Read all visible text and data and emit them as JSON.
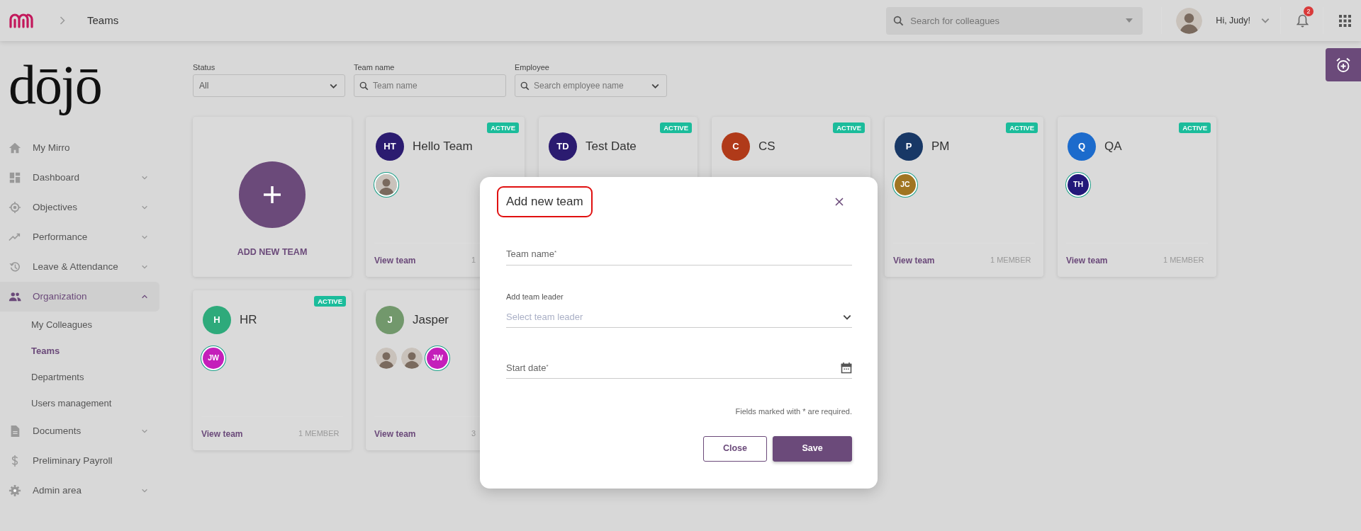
{
  "topbar": {
    "breadcrumb": "Teams",
    "search": {
      "placeholder": "Search for colleagues"
    },
    "greeting": "Hi, Judy!",
    "notifications": "2"
  },
  "sidebar": {
    "logo": "dōjō",
    "items": [
      {
        "kind": "home",
        "label": "My Mirro",
        "selected": false
      },
      {
        "kind": "dashboard",
        "label": "Dashboard",
        "expanded": false,
        "selected": false
      },
      {
        "kind": "objectives",
        "label": "Objectives",
        "expanded": false,
        "selected": false
      },
      {
        "kind": "performance",
        "label": "Performance",
        "expanded": false,
        "selected": false
      },
      {
        "kind": "leave",
        "label": "Leave & Attendance",
        "expanded": false,
        "selected": false
      },
      {
        "kind": "organization",
        "label": "Organization",
        "expanded": true,
        "selected": true,
        "children": [
          {
            "label": "My Colleagues",
            "selected": false
          },
          {
            "label": "Teams",
            "selected": true
          },
          {
            "label": "Departments",
            "selected": false
          },
          {
            "label": "Users management",
            "selected": false
          }
        ]
      },
      {
        "kind": "documents",
        "label": "Documents",
        "expanded": false,
        "selected": false
      },
      {
        "kind": "payroll",
        "label": "Preliminary Payroll",
        "selected": false
      },
      {
        "kind": "admin",
        "label": "Admin area",
        "expanded": false,
        "selected": false
      }
    ]
  },
  "filters": [
    {
      "kind": "select",
      "label": "Status",
      "value": "All"
    },
    {
      "kind": "search",
      "label": "Team name",
      "placeholder": "Team name"
    },
    {
      "kind": "search-select",
      "label": "Employee",
      "placeholder": "Search employee name"
    }
  ],
  "add_team_card": {
    "label": "ADD NEW TEAM"
  },
  "teams": [
    {
      "initials": "HT",
      "name": "Hello Team",
      "color": "#2b1b70",
      "status": "ACTIVE",
      "members": [
        {
          "kind": "photo",
          "outlined": true
        }
      ],
      "link": "View team",
      "member_count": "1"
    },
    {
      "initials": "TD",
      "name": "Test Date",
      "color": "#2b1b70",
      "status": "ACTIVE"
    },
    {
      "initials": "C",
      "name": "CS",
      "color": "#b03a19",
      "status": "ACTIVE"
    },
    {
      "initials": "P",
      "name": "PM",
      "color": "#183866",
      "status": "ACTIVE",
      "members": [
        {
          "kind": "initials",
          "initials": "JC",
          "color": "#a07522",
          "outlined": true
        }
      ],
      "link": "View team",
      "member_count": "1 MEMBER"
    },
    {
      "initials": "Q",
      "name": "QA",
      "color": "#1c6bcc",
      "status": "ACTIVE",
      "members": [
        {
          "kind": "initials",
          "initials": "TH",
          "color": "#23187a",
          "outlined": true
        }
      ],
      "link": "View team",
      "member_count": "1 MEMBER"
    },
    {
      "initials": "H",
      "name": "HR",
      "color": "#2eaa7b",
      "status": "ACTIVE",
      "members": [
        {
          "kind": "initials",
          "initials": "JW",
          "color": "#c41fba",
          "outlined": true
        }
      ],
      "link": "View team",
      "member_count": "1 MEMBER"
    },
    {
      "initials": "J",
      "name": "Jasper",
      "color": "#72986c",
      "members": [
        {
          "kind": "photo",
          "outlined": false
        },
        {
          "kind": "photo",
          "outlined": false
        },
        {
          "kind": "initials",
          "initials": "JW",
          "color": "#c41fba",
          "outlined": true
        }
      ],
      "link": "View team",
      "member_count": "3"
    }
  ],
  "modal": {
    "title": "Add new team",
    "fields": [
      {
        "kind": "text",
        "label": "Team name$^{*}$"
      },
      {
        "kind": "select",
        "label": "Add team leader",
        "placeholder": "Select team leader"
      },
      {
        "kind": "date",
        "label": "Start date$^{*}$"
      }
    ],
    "note": "Fields marked with * are required.",
    "buttons": [
      {
        "kind": "outline",
        "label": "Close"
      },
      {
        "kind": "primary",
        "label": "Save"
      }
    ]
  }
}
